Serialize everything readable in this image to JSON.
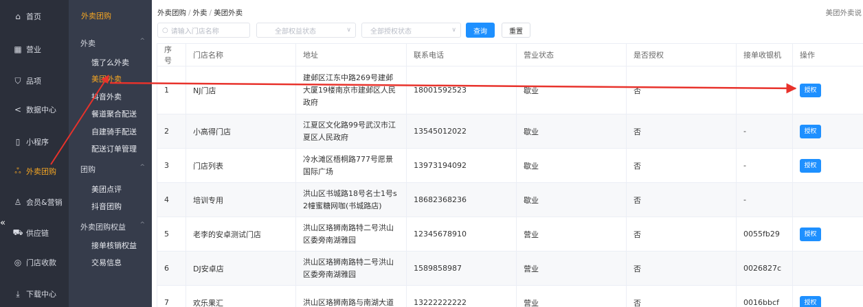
{
  "nav_primary": [
    {
      "label": "首页",
      "icon": "home-icon"
    },
    {
      "label": "营业",
      "icon": "calendar-icon"
    },
    {
      "label": "品项",
      "icon": "bag-icon"
    },
    {
      "label": "数据中心",
      "icon": "share-icon"
    },
    {
      "label": "小程序",
      "icon": "phone-icon"
    },
    {
      "label": "外卖团购",
      "icon": "group-icon",
      "active": true
    },
    {
      "label": "会员&营销",
      "icon": "user-icon"
    },
    {
      "label": "供应链",
      "icon": "truck-icon"
    },
    {
      "label": "门店收款",
      "icon": "coin-icon"
    },
    {
      "label": "下载中心",
      "icon": "download-icon"
    }
  ],
  "collapse_glyph": "«",
  "nav_secondary": {
    "title": "外卖团购",
    "groups": [
      {
        "label": "外卖",
        "items": [
          "饿了么外卖",
          "美团外卖",
          "抖音外卖",
          "餐道聚合配送",
          "自建骑手配送",
          "配送订单管理"
        ]
      },
      {
        "label": "团购",
        "items": [
          "美团点评",
          "抖音团购"
        ]
      },
      {
        "label": "外卖团购权益",
        "items": [
          "接单核销权益",
          "交易信息"
        ]
      }
    ],
    "active_item": "美团外卖"
  },
  "breadcrumb": [
    "外卖团购",
    "外卖",
    "美团外卖"
  ],
  "topright_text": "美团外卖说",
  "filters": {
    "store_placeholder": "请输入门店名称",
    "rights_status": "全部权益状态",
    "auth_status": "全部授权状态",
    "query_label": "查询",
    "reset_label": "重置"
  },
  "table": {
    "headers": [
      "序号",
      "门店名称",
      "地址",
      "联系电话",
      "营业状态",
      "是否授权",
      "接单收银机",
      "操作"
    ],
    "rows": [
      {
        "no": "1",
        "name": "NJ门店",
        "address": "建邺区江东中路269号建邺大厦19楼南京市建邺区人民政府",
        "phone": "18001592523",
        "status": "歇业",
        "authorized": "否",
        "pos": "",
        "action": "授权"
      },
      {
        "no": "2",
        "name": "小高得门店",
        "address": "江夏区文化路99号武汉市江夏区人民政府",
        "phone": "13545012022",
        "status": "歇业",
        "authorized": "否",
        "pos": "-",
        "action": "授权"
      },
      {
        "no": "3",
        "name": "门店列表",
        "address": "冷水滩区梧桐路777号愿景国际广场",
        "phone": "13973194092",
        "status": "歇业",
        "authorized": "否",
        "pos": "-",
        "action": "授权"
      },
      {
        "no": "4",
        "name": "培训专用",
        "address": "洪山区书城路18号名士1号s2幢蜜糖网咖(书城路店)",
        "phone": "18682368236",
        "status": "歇业",
        "authorized": "否",
        "pos": "-",
        "action": ""
      },
      {
        "no": "5",
        "name": "老李的安卓测试门店",
        "address": "洪山区珞狮南路特二号洪山区委旁南湖雅园",
        "phone": "12345678910",
        "status": "营业",
        "authorized": "否",
        "pos": "0055fb29",
        "action": "授权"
      },
      {
        "no": "6",
        "name": "DJ安卓店",
        "address": "洪山区珞狮南路特二号洪山区委旁南湖雅园",
        "phone": "1589858987",
        "status": "营业",
        "authorized": "否",
        "pos": "0026827c",
        "action": ""
      },
      {
        "no": "7",
        "name": "欢乐果汇",
        "address": "洪山区珞狮南路与南湖大道",
        "phone": "13222222222",
        "status": "营业",
        "authorized": "否",
        "pos": "0016bbcf",
        "action": "授权"
      }
    ]
  },
  "colors": {
    "nav_primary_bg": "#2b2f3a",
    "nav_secondary_bg": "#363c4b",
    "accent": "#f5a623",
    "primary_button": "#1e90ff",
    "annotation_arrow": "#e8322b"
  }
}
